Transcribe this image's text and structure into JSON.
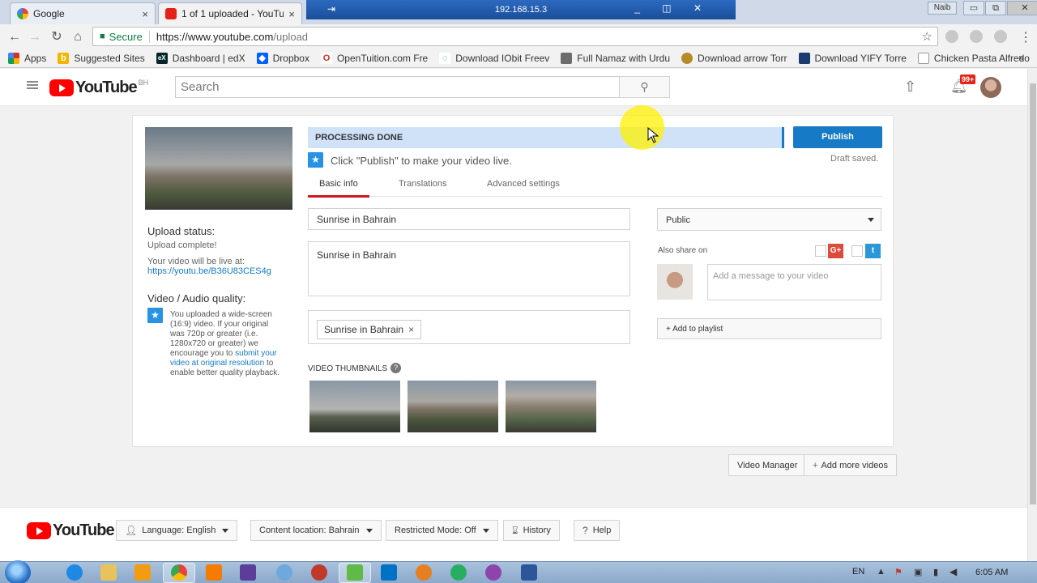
{
  "browser": {
    "tabs": [
      {
        "title": "Google",
        "close": "×"
      },
      {
        "title": "1 of 1 uploaded - YouTub",
        "close": "×"
      }
    ],
    "remote_title": "192.168.15.3",
    "remote_pin": "⇥",
    "remote_controls": "_ ◫ ✕",
    "window_user": "Naib",
    "window_controls": [
      "▭",
      "⧉",
      "✕"
    ],
    "secure_label": "Secure",
    "url_host": "https://www.youtube.com",
    "url_path": "/upload",
    "bookmarks": [
      {
        "label": "Apps",
        "icon": "apps-grid-icon",
        "color": "#d93025"
      },
      {
        "label": "Suggested Sites",
        "icon": "bing-icon",
        "color": "#f4b400"
      },
      {
        "label": "Dashboard | edX",
        "icon": "edx-icon",
        "color": "#02262b"
      },
      {
        "label": "Dropbox",
        "icon": "dropbox-icon",
        "color": "#0061ff"
      },
      {
        "label": "OpenTuition.com Fre",
        "icon": "opentuition-icon",
        "color": "#d62d20"
      },
      {
        "label": "Download IObit Freev",
        "icon": "iobit-icon",
        "color": "#1e88e5"
      },
      {
        "label": "Full Namaz with Urdu",
        "icon": "image-icon",
        "color": "#6d6d6d"
      },
      {
        "label": "Download arrow Torr",
        "icon": "shield-icon",
        "color": "#b78a2a"
      },
      {
        "label": "Download YIFY Torre",
        "icon": "film-icon",
        "color": "#1a3c6e"
      },
      {
        "label": "Chicken Pasta Alfredo",
        "icon": "page-icon",
        "color": "#999999"
      }
    ],
    "bookmarks_more": "»"
  },
  "youtube": {
    "logo_word": "YouTube",
    "country": "BH",
    "search_placeholder": "Search",
    "notifications": "99+"
  },
  "upload": {
    "status_title": "Upload status:",
    "status_text": "Upload complete!",
    "live_at_text": "Your video will be live at:",
    "video_link": "https://youtu.be/B36U83CES4g",
    "quality_title": "Video / Audio quality:",
    "quality_text_1": "You uploaded a wide-screen (16:9) video. If your original was 720p or greater (i.e. 1280x720 or greater) we encourage you to",
    "quality_link": "submit your video at original resolution",
    "quality_text_2": "to enable better quality playback.",
    "progress_text": "PROCESSING DONE",
    "publish_label": "Publish",
    "draft_status": "Draft saved.",
    "make_live_text": "Click \"Publish\" to make your video live.",
    "tabs": [
      "Basic info",
      "Translations",
      "Advanced settings"
    ],
    "title_value": "Sunrise in Bahrain",
    "description_value": "Sunrise in Bahrain",
    "tag_chip": "Sunrise in Bahrain",
    "tag_remove": "×",
    "thumbnails_title": "VIDEO THUMBNAILS",
    "help": "?",
    "privacy_value": "Public",
    "also_share_label": "Also share on",
    "gplus_label": "G+",
    "twitter_label": "t",
    "share_message_placeholder": "Add a message to your video",
    "playlist_label": "+ Add to playlist"
  },
  "actions": {
    "video_manager": "Video Manager",
    "add_more_videos": "Add more videos"
  },
  "footer": {
    "logo_word": "YouTube",
    "language": "Language: English",
    "content_location": "Content location: Bahrain",
    "restricted_mode": "Restricted Mode: Off",
    "history": "History",
    "help": "Help"
  },
  "taskbar": {
    "language": "EN",
    "time": "6:05 AM"
  }
}
